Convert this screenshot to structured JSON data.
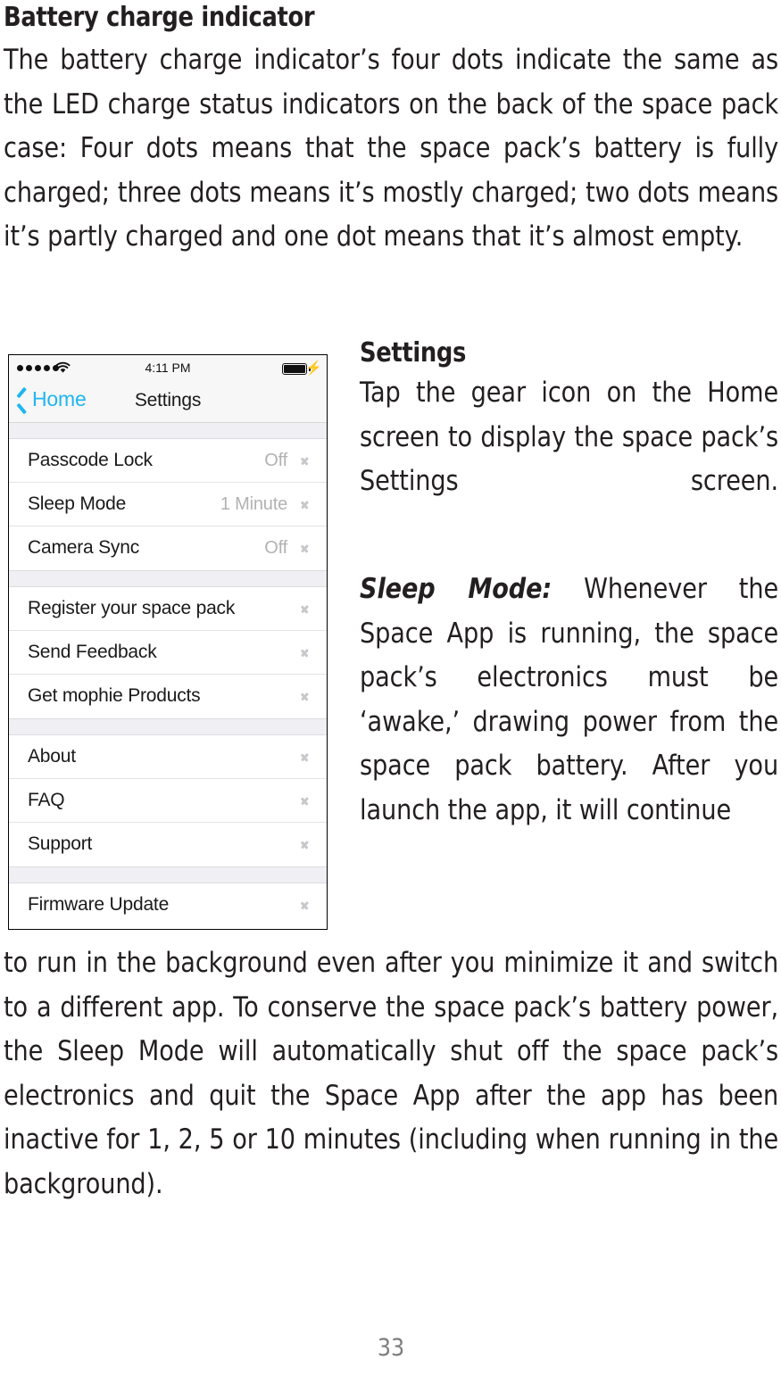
{
  "document": {
    "page_number": "33"
  },
  "sections": {
    "battery": {
      "title": "Battery charge indicator",
      "paragraph": "The battery charge indicator’s four dots indicate the same as the LED charge status indicators on the back of the space pack case: Four dots means that the space pack’s battery is fully charged; three dots means it’s mostly charged; two dots means it’s partly charged and one dot means that it’s almost empty."
    },
    "settings": {
      "title": "Settings",
      "paragraph": "Tap the gear icon on the Home screen to display the space pack’s Settings screen."
    },
    "sleep_mode": {
      "lead_in": "Sleep Mode:",
      "paragraph_start": " Whenever the Space App is running, the space pack’s electronics must be ‘awake,’ drawing power from the space pack battery. After you launch the app, it will continue",
      "paragraph_rest": "to run in the background even after you minimize it and switch to a different app. To conserve the space pack’s battery power, the Sleep Mode will automatically shut off the space pack’s electronics and quit the Space App after the app has been inactive for 1, 2, 5 or 10 minutes (including when running in the background)."
    }
  },
  "phone_screenshot": {
    "status_bar": {
      "signal_dots": 5,
      "wifi_icon": "wifi-icon",
      "time": "4:11 PM",
      "battery_icon": "battery-full-icon",
      "charging_icon": "lightning-bolt-icon"
    },
    "nav_bar": {
      "back_icon": "chevron-left-icon",
      "back_label": "Home",
      "title": "Settings"
    },
    "groups": [
      {
        "rows": [
          {
            "label": "Passcode Lock",
            "value": "Off",
            "chevron": "chevron-right-icon"
          },
          {
            "label": "Sleep Mode",
            "value": "1 Minute",
            "chevron": "chevron-right-icon"
          },
          {
            "label": "Camera Sync",
            "value": "Off",
            "chevron": "chevron-right-icon"
          }
        ]
      },
      {
        "rows": [
          {
            "label": "Register your space pack",
            "value": "",
            "chevron": "chevron-right-icon"
          },
          {
            "label": "Send Feedback",
            "value": "",
            "chevron": "chevron-right-icon"
          },
          {
            "label": "Get mophie Products",
            "value": "",
            "chevron": "chevron-right-icon"
          }
        ]
      },
      {
        "rows": [
          {
            "label": "About",
            "value": "",
            "chevron": "chevron-right-icon"
          },
          {
            "label": "FAQ",
            "value": "",
            "chevron": "chevron-right-icon"
          },
          {
            "label": "Support",
            "value": "",
            "chevron": "chevron-right-icon"
          }
        ]
      },
      {
        "rows": [
          {
            "label": "Firmware Update",
            "value": "",
            "chevron": "chevron-right-icon"
          }
        ]
      }
    ]
  },
  "colors": {
    "text": "#231f20",
    "accent_blue": "#1fb6ef",
    "muted_gray": "#b2b2b2",
    "chrome_gray": "#f7f7f7",
    "group_gap": "#efeff4"
  }
}
